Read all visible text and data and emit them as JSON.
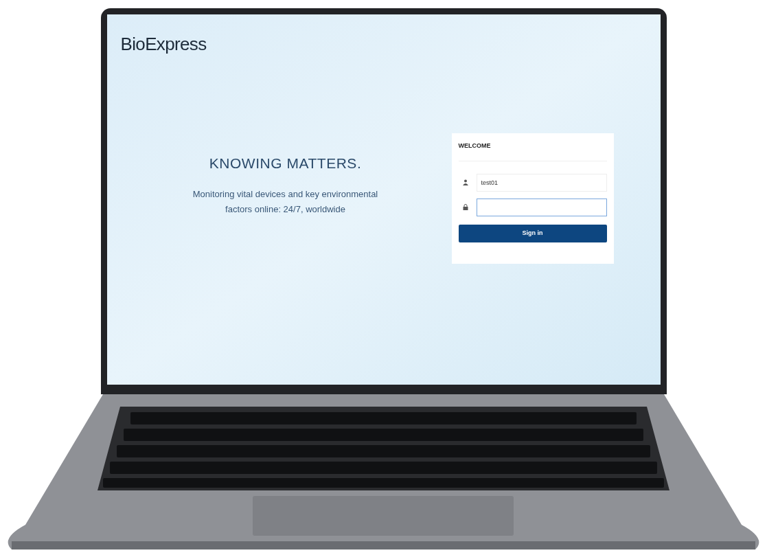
{
  "logo": "BioExpress",
  "hero": {
    "headline": "KNOWING MATTERS.",
    "tagline": "Monitoring vital devices and key environmental factors online: 24/7, worldwide"
  },
  "login": {
    "title": "WELCOME",
    "fields": [
      {
        "kind": "user",
        "value": "test01",
        "focused": false
      },
      {
        "kind": "password",
        "focused": true
      }
    ],
    "button": "Sign in"
  }
}
